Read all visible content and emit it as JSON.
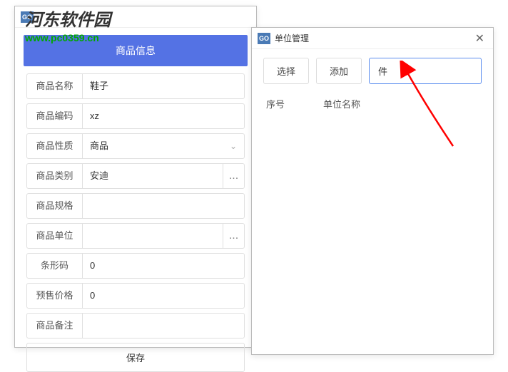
{
  "watermark": {
    "text": "河东软件园",
    "url": "www.pc0359.cn"
  },
  "back_window": {
    "icon": "GO",
    "banner": "商品信息",
    "fields": {
      "name_label": "商品名称",
      "name_value": "鞋子",
      "code_label": "商品编码",
      "code_value": "xz",
      "nature_label": "商品性质",
      "nature_value": "商品",
      "category_label": "商品类别",
      "category_value": "安迪",
      "spec_label": "商品规格",
      "spec_value": "",
      "unit_label": "商品单位",
      "unit_value": "",
      "barcode_label": "条形码",
      "barcode_value": "0",
      "price_label": "预售价格",
      "price_value": "0",
      "remark_label": "商品备注",
      "remark_value": ""
    },
    "save_label": "保存"
  },
  "front_window": {
    "icon": "GO",
    "title": "单位管理",
    "select_label": "选择",
    "add_label": "添加",
    "input_value": "件",
    "col_seq": "序号",
    "col_name": "单位名称"
  }
}
